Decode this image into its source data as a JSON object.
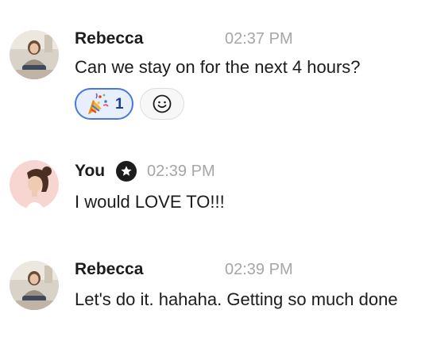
{
  "messages": [
    {
      "author": "Rebecca",
      "time": "02:37 PM",
      "text": "Can we stay on for the next 4 hours?",
      "reactions": [
        {
          "emoji": "party-popper-icon",
          "count": "1",
          "selected": true
        }
      ],
      "avatar": "rebecca-avatar"
    },
    {
      "author": "You",
      "time": "02:39 PM",
      "text": "I would LOVE TO!!!",
      "badge": "star-badge-icon",
      "avatar": "you-avatar"
    },
    {
      "author": "Rebecca",
      "time": "02:39 PM",
      "text": "Let's do it.  hahaha.  Getting so much done",
      "avatar": "rebecca-avatar"
    }
  ],
  "colors": {
    "author_text": "#1d1c1d",
    "timestamp": "#a6a6a6",
    "reaction_selected_border": "#4a78d9",
    "reaction_selected_bg": "#e8effc"
  }
}
